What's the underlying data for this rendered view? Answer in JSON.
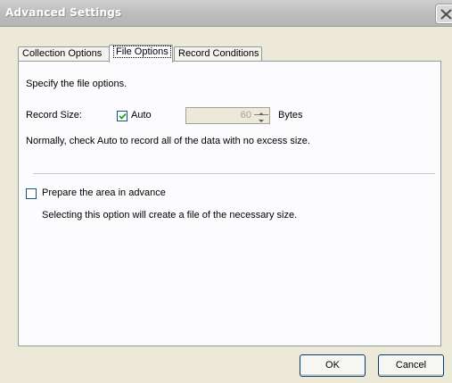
{
  "window": {
    "title": "Advanced Settings"
  },
  "tabs": [
    {
      "label": "Collection Options",
      "active": false
    },
    {
      "label": "File Options",
      "active": true
    },
    {
      "label": "Record Conditions",
      "active": false
    }
  ],
  "file_options": {
    "description": "Specify the file options.",
    "record_size_label": "Record Size:",
    "auto_label": "Auto",
    "auto_checked": true,
    "size_value": "60",
    "size_unit": "Bytes",
    "auto_hint": "Normally, check Auto to record all of the data with no excess size.",
    "prepare_label": "Prepare the area in advance",
    "prepare_checked": false,
    "prepare_hint": "Selecting this option will create a file of the necessary size."
  },
  "buttons": {
    "ok": "OK",
    "cancel": "Cancel"
  },
  "icons": {
    "close": "close-icon",
    "check": "checkmark-icon",
    "spin_up": "arrow-up-icon",
    "spin_down": "arrow-down-icon"
  }
}
